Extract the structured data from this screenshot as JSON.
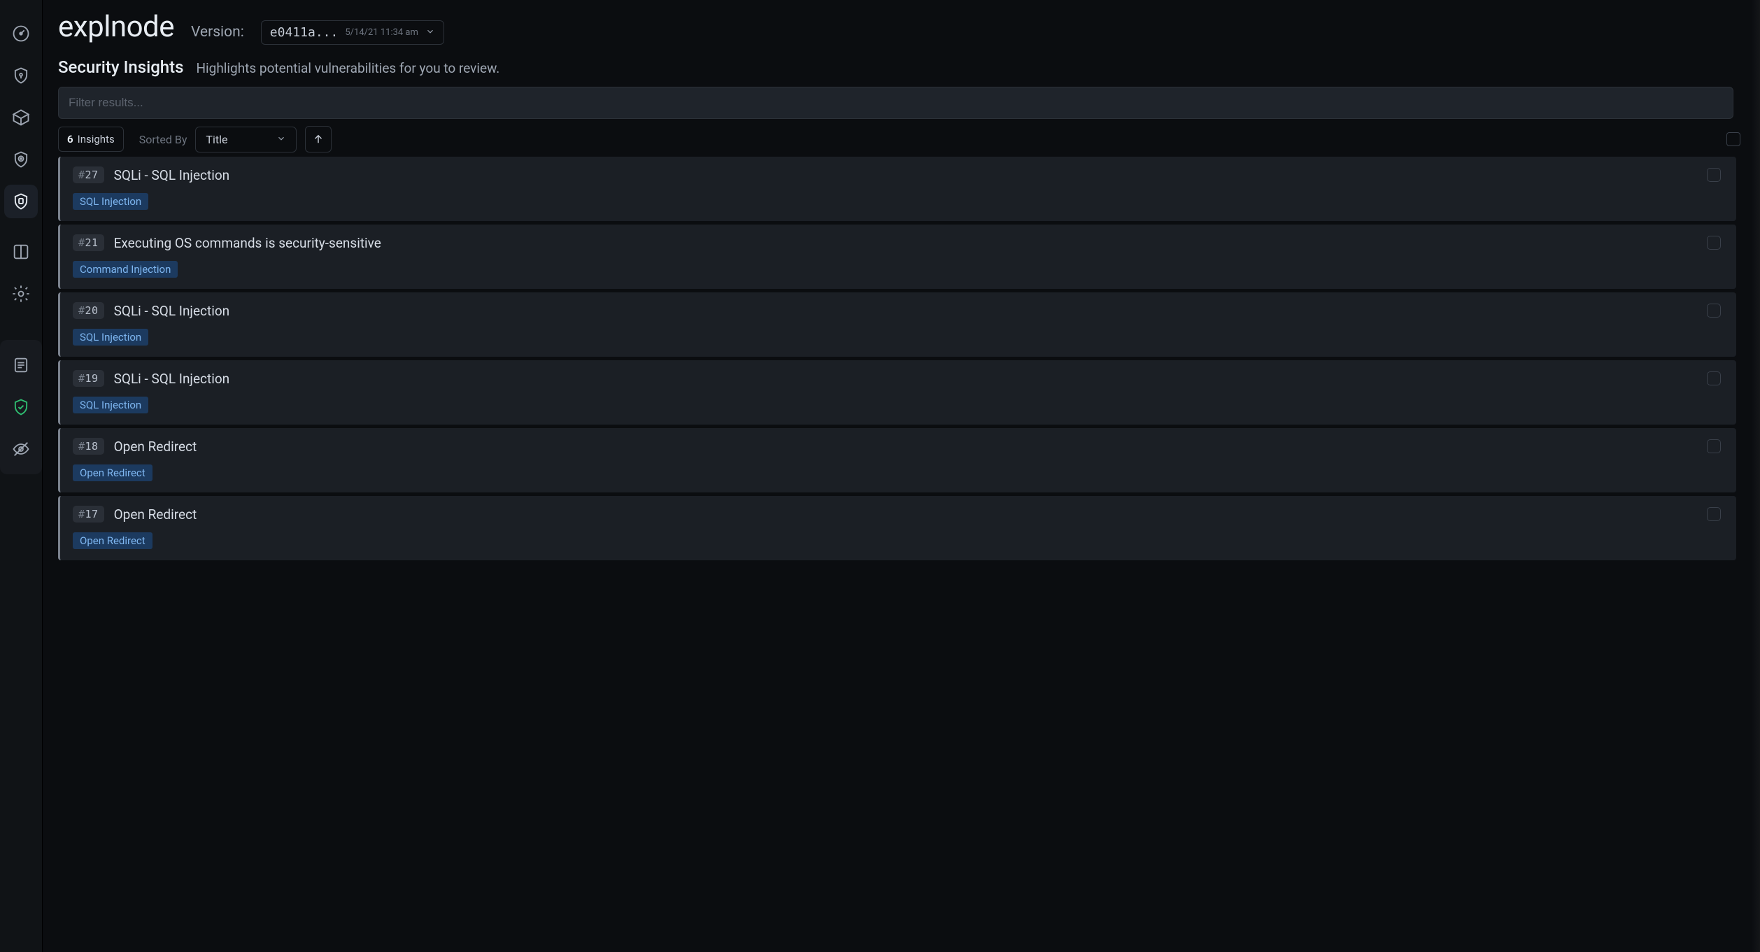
{
  "app": {
    "title": "explnode"
  },
  "version": {
    "label": "Version:",
    "hash": "e0411a...",
    "date": "5/14/21 11:34 am"
  },
  "page": {
    "heading": "Security Insights",
    "description": "Highlights potential vulnerabilities for you to review."
  },
  "filter": {
    "placeholder": "Filter results..."
  },
  "toolbar": {
    "count": "6",
    "count_unit": "Insights",
    "sorted_by_label": "Sorted By",
    "sort_field": "Title"
  },
  "sidebar": {
    "top": [
      "dashboard",
      "lock",
      "package",
      "target",
      "shield-badge"
    ],
    "mid": [
      "columns",
      "settings"
    ],
    "bottom": [
      "notes",
      "status-good",
      "visibility-off"
    ]
  },
  "insights": [
    {
      "id": "27",
      "title": "SQLi - SQL Injection",
      "tag": "SQL Injection"
    },
    {
      "id": "21",
      "title": "Executing OS commands is security-sensitive",
      "tag": "Command Injection"
    },
    {
      "id": "20",
      "title": "SQLi - SQL Injection",
      "tag": "SQL Injection"
    },
    {
      "id": "19",
      "title": "SQLi - SQL Injection",
      "tag": "SQL Injection"
    },
    {
      "id": "18",
      "title": "Open Redirect",
      "tag": "Open Redirect"
    },
    {
      "id": "17",
      "title": "Open Redirect",
      "tag": "Open Redirect"
    }
  ]
}
